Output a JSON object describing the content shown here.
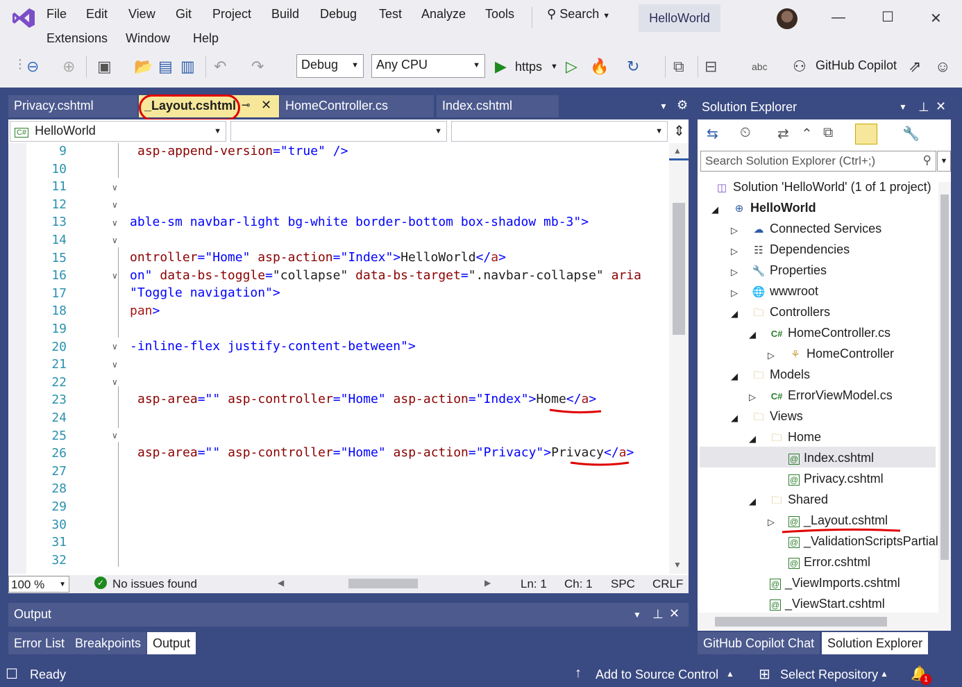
{
  "menu": {
    "row1": [
      "File",
      "Edit",
      "View",
      "Git",
      "Project",
      "Build",
      "Debug",
      "Test",
      "Analyze",
      "Tools"
    ],
    "row2": [
      "Extensions",
      "Window",
      "Help"
    ],
    "search_label": "Search",
    "solution_name": "HelloWorld"
  },
  "toolbar": {
    "config": "Debug",
    "platform": "Any CPU",
    "run_target": "https",
    "copilot": "GitHub Copilot"
  },
  "tabs": [
    "Privacy.cshtml",
    "_Layout.cshtml",
    "HomeController.cs",
    "Index.cshtml"
  ],
  "editor": {
    "project_combo": "HelloWorld",
    "zoom": "100 %",
    "issues": "No issues found",
    "ln": "Ln: 1",
    "ch": "Ch: 1",
    "spc": "SPC",
    "eol": "CRLF",
    "line_numbers": [
      "9",
      "10",
      "11",
      "12",
      "13",
      "14",
      "15",
      "16",
      "17",
      "18",
      "19",
      "20",
      "21",
      "22",
      "23",
      "24",
      "25",
      "26",
      "27",
      "28",
      "29",
      "30",
      "31",
      "32"
    ]
  },
  "solution_explorer": {
    "title": "Solution Explorer",
    "search_placeholder": "Search Solution Explorer (Ctrl+;)",
    "items": [
      {
        "label": "Solution 'HelloWorld' (1 of 1 project)",
        "icon": "solution-icon"
      },
      {
        "label": "HelloWorld",
        "icon": "web-project-icon"
      },
      {
        "label": "Connected Services",
        "icon": "connected-services-icon"
      },
      {
        "label": "Dependencies",
        "icon": "dependencies-icon"
      },
      {
        "label": "Properties",
        "icon": "properties-icon"
      },
      {
        "label": "wwwroot",
        "icon": "globe-icon"
      },
      {
        "label": "Controllers",
        "icon": "folder-icon"
      },
      {
        "label": "HomeController.cs",
        "icon": "csharp-file-icon"
      },
      {
        "label": "HomeController",
        "icon": "class-icon"
      },
      {
        "label": "Models",
        "icon": "folder-icon"
      },
      {
        "label": "ErrorViewModel.cs",
        "icon": "csharp-file-icon"
      },
      {
        "label": "Views",
        "icon": "folder-icon"
      },
      {
        "label": "Home",
        "icon": "folder-icon"
      },
      {
        "label": "Index.cshtml",
        "icon": "razor-file-icon"
      },
      {
        "label": "Privacy.cshtml",
        "icon": "razor-file-icon"
      },
      {
        "label": "Shared",
        "icon": "folder-icon"
      },
      {
        "label": "_Layout.cshtml",
        "icon": "razor-file-icon"
      },
      {
        "label": "_ValidationScriptsPartial",
        "icon": "razor-file-icon"
      },
      {
        "label": "Error.cshtml",
        "icon": "razor-file-icon"
      },
      {
        "label": "_ViewImports.cshtml",
        "icon": "razor-file-icon"
      },
      {
        "label": "_ViewStart.cshtml",
        "icon": "razor-file-icon"
      }
    ]
  },
  "bottom": {
    "output_title": "Output",
    "tabs": [
      "Error List",
      "Breakpoints",
      "Output"
    ],
    "right_tabs": [
      "GitHub Copilot Chat",
      "Solution Explorer"
    ]
  },
  "status": {
    "ready": "Ready",
    "source_control": "Add to Source Control",
    "repository": "Select Repository",
    "notifications": "1"
  },
  "colors": {
    "accent": "#3a4a82",
    "active_tab": "#f6e79a",
    "annotation": "#e00000"
  }
}
